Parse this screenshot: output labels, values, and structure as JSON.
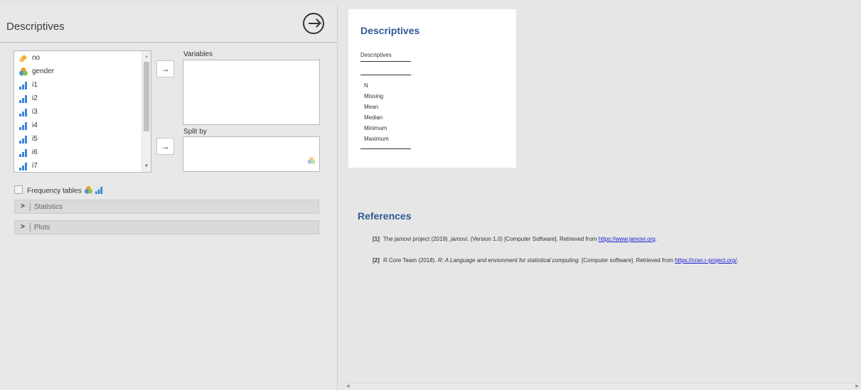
{
  "left_panel": {
    "title": "Descriptives",
    "variables": [
      {
        "name": "no",
        "icon": "nominal-text-icon"
      },
      {
        "name": "gender",
        "icon": "nominal-icon"
      },
      {
        "name": "i1",
        "icon": "continuous-icon"
      },
      {
        "name": "i2",
        "icon": "continuous-icon"
      },
      {
        "name": "i3",
        "icon": "continuous-icon"
      },
      {
        "name": "i4",
        "icon": "continuous-icon"
      },
      {
        "name": "i5",
        "icon": "continuous-icon"
      },
      {
        "name": "i6",
        "icon": "continuous-icon"
      },
      {
        "name": "i7",
        "icon": "continuous-icon"
      }
    ],
    "move_arrow": "→",
    "variables_label": "Variables",
    "split_by_label": "Split by",
    "frequency_tables_label": "Frequency tables",
    "sections": [
      {
        "label": "Statistics"
      },
      {
        "label": "Plots"
      }
    ]
  },
  "results": {
    "heading": "Descriptives",
    "table_caption": "Descriptives",
    "stats_rows": [
      "N",
      "Missing",
      "Mean",
      "Median",
      "Minimum",
      "Maximum"
    ],
    "references_heading": "References",
    "references": [
      {
        "num": "[1]",
        "pre": "The jamovi project (2019).",
        "italic": "jamovi.",
        "post": "(Version 1.0) [Computer Software]. Retrieved from",
        "link": "https://www.jamovi.org",
        "end": "."
      },
      {
        "num": "[2]",
        "pre": "R Core Team (2018).",
        "italic": "R: A Language and envionment for statistical computing.",
        "post": "[Computer software]. Retrieved from",
        "link": "https://cran.r-project.org/",
        "end": "."
      }
    ]
  },
  "colors": {
    "heading_blue": "#2f5a96",
    "nominal_text_orange": "#f0b232",
    "continuous_blue": "#3a86d6",
    "nominal_venn": [
      "#f0a320",
      "#4d90d8",
      "#8cc34a"
    ]
  }
}
